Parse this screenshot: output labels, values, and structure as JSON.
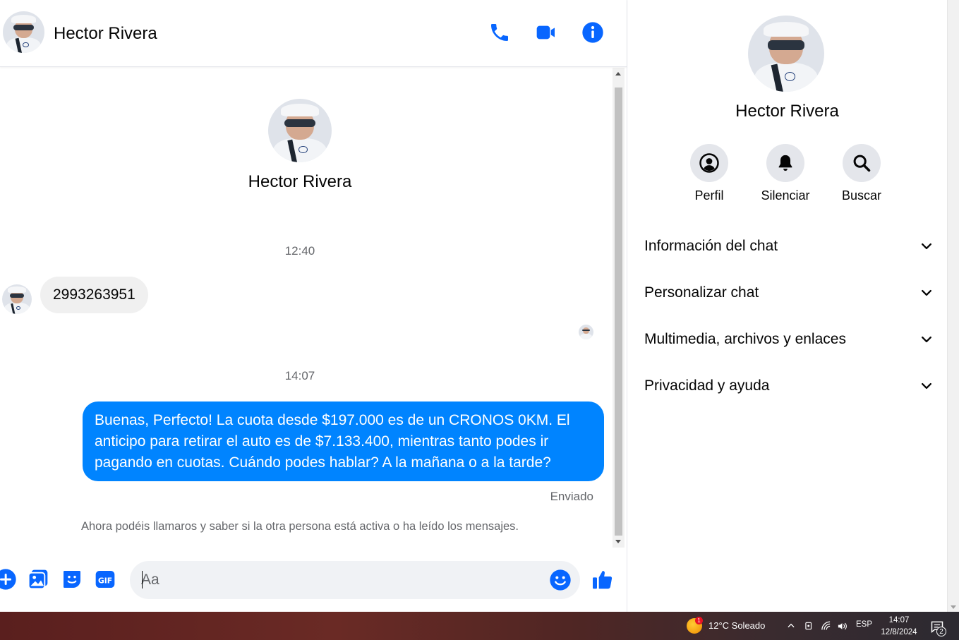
{
  "header": {
    "contact_name": "Hector Rivera",
    "icons": [
      "phone-icon",
      "video-camera-icon",
      "info-icon"
    ]
  },
  "conversation": {
    "intro_name": "Hector Rivera",
    "messages": [
      {
        "type": "timestamp",
        "text": "12:40"
      },
      {
        "type": "incoming",
        "text": "2993263951"
      },
      {
        "type": "timestamp",
        "text": "14:07"
      },
      {
        "type": "outgoing",
        "text": "Buenas, Perfecto! La cuota desde $197.000 es de un CRONOS 0KM. El anticipo para retirar el auto es de $7.133.400, mientras tanto podes ir pagando en cuotas. Cuándo podes hablar? A la mañana o a la tarde?"
      }
    ],
    "status": "Enviado",
    "notice": "Ahora podéis llamaros y saber si la otra persona está activa o ha leído los mensajes."
  },
  "composer": {
    "placeholder": "Aa",
    "icons": [
      "plus-icon",
      "photo-icon",
      "sticker-icon",
      "gif-icon",
      "emoji-icon",
      "like-icon"
    ]
  },
  "info_panel": {
    "name": "Hector Rivera",
    "actions": [
      {
        "label": "Perfil",
        "icon": "profile-icon"
      },
      {
        "label": "Silenciar",
        "icon": "bell-icon"
      },
      {
        "label": "Buscar",
        "icon": "search-icon"
      }
    ],
    "sections": [
      {
        "label": "Información del chat"
      },
      {
        "label": "Personalizar chat"
      },
      {
        "label": "Multimedia, archivos y enlaces"
      },
      {
        "label": "Privacidad y ayuda"
      }
    ]
  },
  "taskbar": {
    "weather_badge": "1",
    "weather": "12°C  Soleado",
    "language": "ESP",
    "time": "14:07",
    "date": "12/8/2024",
    "notification_count": "2"
  },
  "colors": {
    "accent": "#0084ff",
    "icon_blue": "#0866ff",
    "incoming_bubble": "#f0f0f0",
    "secondary_text": "#65676b"
  }
}
